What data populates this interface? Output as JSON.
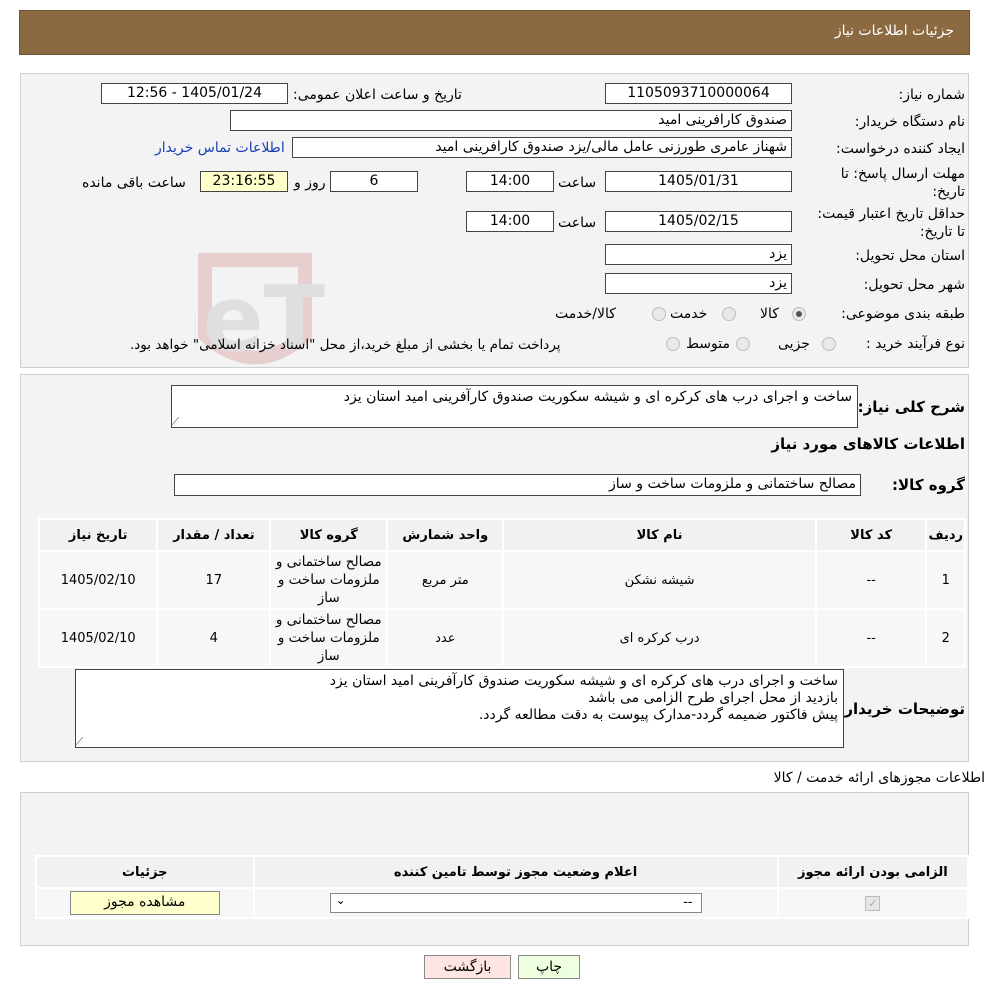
{
  "header": {
    "title": "جزئیات اطلاعات نیاز"
  },
  "details": {
    "need_number_label": "شماره نیاز:",
    "need_number": "1105093710000064",
    "announce_label": "تاریخ و ساعت اعلان عمومی:",
    "announce_value": "1405/01/24 - 12:56",
    "buyer_label": "نام دستگاه خریدار:",
    "buyer_value": "صندوق کارافرینی امید",
    "creator_label": "ایجاد کننده درخواست:",
    "creator_value": "شهناز عامری طورزنی عامل مالی/یزد صندوق کارافرینی امید",
    "contact_link": "اطلاعات تماس خریدار",
    "deadline_label": "مهلت ارسال پاسخ: تا تاریخ:",
    "deadline_date": "1405/01/31",
    "time_label": "ساعت",
    "deadline_time": "14:00",
    "days_value": "6",
    "days_label": "روز و",
    "remaining_time": "23:16:55",
    "remaining_label": "ساعت باقی مانده",
    "validity_label": "حداقل تاریخ اعتبار قیمت: تا تاریخ:",
    "validity_date": "1405/02/15",
    "validity_time": "14:00",
    "province_label": "استان محل تحویل:",
    "province_value": "یزد",
    "city_label": "شهر محل تحویل:",
    "city_value": "یزد",
    "category_label": "طبقه بندی موضوعی:",
    "category_options": [
      "کالا",
      "خدمت",
      "کالا/خدمت"
    ],
    "category_selected": "کالا",
    "process_label": "نوع فرآیند خرید :",
    "process_options": [
      "جزیی",
      "متوسط"
    ],
    "process_note": "پرداخت تمام یا بخشی از مبلغ خرید،از محل \"اسناد خزانه اسلامی\" خواهد بود."
  },
  "summary": {
    "desc_label": "شرح کلی نیاز:",
    "desc_value": "ساخت و اجرای درب های کرکره ای و شیشه سکوریت صندوق کارآفرینی امید استان یزد",
    "goods_title": "اطلاعات کالاهای مورد نیاز",
    "group_label": "گروه کالا:",
    "group_value": "مصالح ساختمانی و ملزومات ساخت و ساز",
    "table_headers": [
      "ردیف",
      "کد کالا",
      "نام کالا",
      "واحد شمارش",
      "گروه کالا",
      "تعداد / مقدار",
      "تاریخ نیاز"
    ],
    "rows": [
      {
        "row": "1",
        "code": "--",
        "name": "شیشه نشکن",
        "unit": "متر مربع",
        "group": "مصالح ساختمانی و ملزومات ساخت و ساز",
        "qty": "17",
        "date": "1405/02/10"
      },
      {
        "row": "2",
        "code": "--",
        "name": "درب کرکره ای",
        "unit": "عدد",
        "group": "مصالح ساختمانی و ملزومات ساخت و ساز",
        "qty": "4",
        "date": "1405/02/10"
      }
    ],
    "buyer_notes_label": "توضیحات خریدار:",
    "buyer_notes": [
      "ساخت و اجرای درب های کرکره ای و شیشه سکوریت صندوق کارآفرینی امید استان یزد",
      "بازدید از محل اجرای طرح الزامی می باشد",
      "پیش فاکتور ضمیمه گردد-مدارک پیوست به دقت مطالعه گردد."
    ]
  },
  "permits": {
    "section_title": "اطلاعات مجوزهای ارائه خدمت / کالا",
    "headers": [
      "الزامی بودن ارائه مجوز",
      "اعلام وضعیت مجوز توسط تامین کننده",
      "جزئیات"
    ],
    "select_value": "--",
    "view_button": "مشاهده مجوز"
  },
  "footer": {
    "print_button": "چاپ",
    "back_button": "بازگشت"
  },
  "watermark": {
    "text": "AriaTender.neT"
  }
}
